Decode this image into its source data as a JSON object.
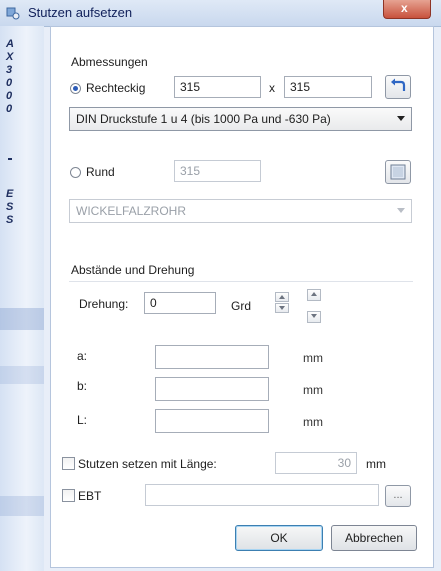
{
  "window": {
    "title": "Stutzen aufsetzen",
    "close_label": "x"
  },
  "side_strip": {
    "letters_top": [
      "A",
      "X",
      "3",
      "0",
      "0",
      "0"
    ],
    "letters_bottom": [
      "E",
      "S",
      "S"
    ]
  },
  "dimensions": {
    "group_label": "Abmessungen",
    "rect": {
      "label": "Rechteckig",
      "width": "315",
      "sep": "x",
      "height": "315",
      "selected": true
    },
    "rect_class": "DIN Druckstufe 1 u 4 (bis 1000 Pa und -630 Pa)",
    "round": {
      "label": "Rund",
      "diameter": "315",
      "selected": false
    },
    "round_type": "WICKELFALZROHR"
  },
  "distances": {
    "group_label": "Abstände und Drehung",
    "rotation_label": "Drehung:",
    "rotation_value": "0",
    "rotation_unit": "Grd",
    "a_label": "a:",
    "a_value": "",
    "b_label": "b:",
    "b_value": "",
    "l_label": "L:",
    "l_value": "",
    "unit": "mm"
  },
  "stutzen_length": {
    "label": "Stutzen setzen mit Länge:",
    "value": "30",
    "unit": "mm",
    "checked": false
  },
  "ebt": {
    "label": "EBT",
    "value": "",
    "browse_label": "...",
    "checked": false
  },
  "buttons": {
    "ok": "OK",
    "cancel": "Abbrechen"
  }
}
